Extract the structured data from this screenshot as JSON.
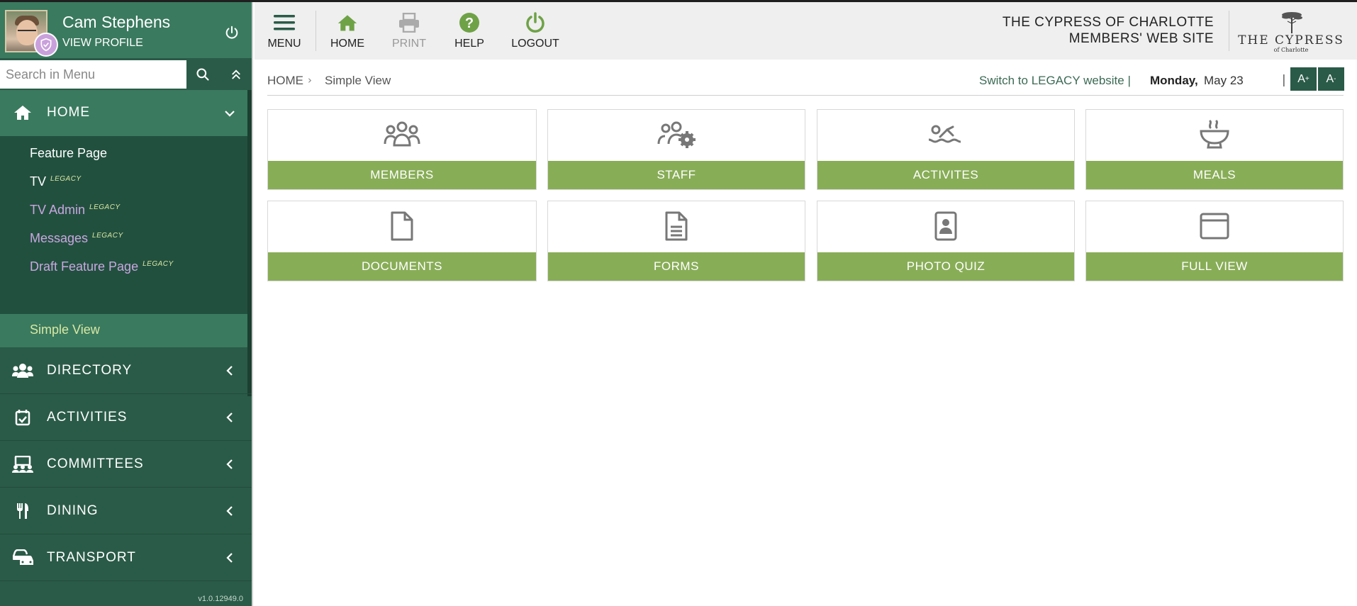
{
  "sidebar": {
    "user": {
      "name": "Cam Stephens",
      "profile_link": "VIEW PROFILE"
    },
    "search": {
      "placeholder": "Search in Menu"
    },
    "home": {
      "label": "HOME",
      "items": [
        {
          "label": "Feature Page",
          "tag": ""
        },
        {
          "label": "TV",
          "tag": "LEGACY"
        },
        {
          "label": "TV Admin",
          "tag": "LEGACY"
        },
        {
          "label": "Messages",
          "tag": "LEGACY"
        },
        {
          "label": "Draft Feature Page",
          "tag": "LEGACY"
        },
        {
          "label": "Simple View",
          "tag": ""
        }
      ]
    },
    "sections": [
      {
        "label": "DIRECTORY",
        "icon": "users-icon"
      },
      {
        "label": "ACTIVITIES",
        "icon": "calendar-check-icon"
      },
      {
        "label": "COMMITTEES",
        "icon": "committee-icon"
      },
      {
        "label": "DINING",
        "icon": "utensils-icon"
      },
      {
        "label": "TRANSPORT",
        "icon": "cars-icon"
      }
    ],
    "version": "v1.0.12949.0"
  },
  "toolbar": {
    "menu": "MENU",
    "home": "HOME",
    "print": "PRINT",
    "help": "HELP",
    "logout": "LOGOUT"
  },
  "site": {
    "title_line1": "THE CYPRESS OF CHARLOTTE",
    "title_line2": "MEMBERS' WEB SITE",
    "logo_text": "THE CYPRESS",
    "logo_sub": "of Charlotte"
  },
  "breadcrumb": {
    "home": "HOME",
    "separator": "›",
    "current": "Simple View"
  },
  "header_right": {
    "legacy_link": "Switch to LEGACY website |",
    "date_day": "Monday,",
    "date_rest": "May 23",
    "separator": "|",
    "font_up": "A",
    "font_down": "A"
  },
  "tiles": [
    {
      "label": "MEMBERS",
      "icon": "members-icon"
    },
    {
      "label": "STAFF",
      "icon": "staff-gear-icon"
    },
    {
      "label": "ACTIVITES",
      "icon": "swimmer-icon"
    },
    {
      "label": "MEALS",
      "icon": "bowl-icon"
    },
    {
      "label": "DOCUMENTS",
      "icon": "document-icon"
    },
    {
      "label": "FORMS",
      "icon": "form-icon"
    },
    {
      "label": "PHOTO QUIZ",
      "icon": "photo-id-icon"
    },
    {
      "label": "FULL VIEW",
      "icon": "window-icon"
    }
  ],
  "colors": {
    "sidebar": "#2a5b48",
    "sidebar_active": "#3a7a5f",
    "accent_green": "#88ad57",
    "toolbar_icon": "#6fa247",
    "legacy_purple": "#c9a7e0"
  }
}
